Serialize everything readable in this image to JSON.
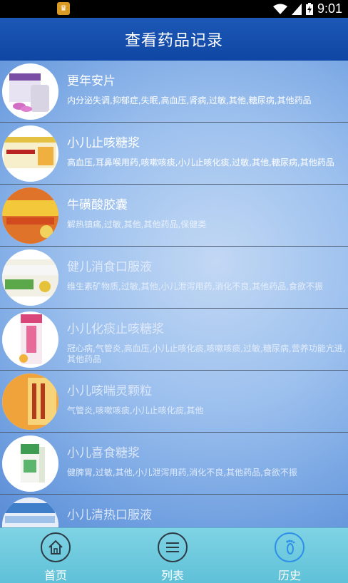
{
  "status_bar": {
    "time": "9:01",
    "app_icon": "launcher-app-icon"
  },
  "header": {
    "title": "查看药品记录"
  },
  "items": [
    {
      "name": "更年安片",
      "desc": "内分泌失调,抑郁症,失眠,高血压,肾病,过敏,其他,糖尿病,其他药品",
      "name_color": "#ffffff",
      "desc_color": "#ffffff",
      "thumb": "pill-box-purple"
    },
    {
      "name": "小儿止咳糖浆",
      "desc": "高血压,耳鼻喉用药,咳嗽咳痰,小儿止咳化痰,过敏,其他,糖尿病,其他药品",
      "name_color": "#ffffff",
      "desc_color": "#ffffff",
      "thumb": "syrup-box-yellow"
    },
    {
      "name": "牛磺酸胶囊",
      "desc": "解热镇痛,过敏,其他,其他药品,保健类",
      "name_color": "#ffffff",
      "desc_color": "#e8f1fb",
      "thumb": "capsule-box-orange"
    },
    {
      "name": "健儿消食口服液",
      "desc": "维生素矿物质,过敏,其他,小儿泄泻用药,消化不良,其他药品,食欲不振",
      "name_color": "#dfeafa",
      "desc_color": "#e4eefb",
      "thumb": "oral-liquid-box-green"
    },
    {
      "name": "小儿化痰止咳糖浆",
      "desc": "冠心病,气管炎,高血压,小儿止咳化痰,咳嗽咳痰,过敏,糖尿病,营养功能亢进,其他药品",
      "name_color": "#dde8f9",
      "desc_color": "#e2ecfa",
      "thumb": "syrup-bottle-pink"
    },
    {
      "name": "小儿咳喘灵颗粒",
      "desc": "气管炎,咳嗽咳痰,小儿止咳化痰,其他",
      "name_color": "#dbe7f8",
      "desc_color": "#e0ebfa",
      "thumb": "granule-box-orange"
    },
    {
      "name": "小儿喜食糖浆",
      "desc": "健脾胃,过敏,其他,小儿泄泻用药,消化不良,其他药品,食欲不振",
      "name_color": "#dae6f8",
      "desc_color": "#dfeafa",
      "thumb": "syrup-box-green"
    },
    {
      "name": "小儿清热口服液",
      "desc": "",
      "name_color": "#d8e5f7",
      "desc_color": "#dde9f9",
      "thumb": "oral-liquid-box-blue"
    }
  ],
  "tabbar": {
    "tabs": [
      {
        "label": "首页",
        "icon": "home-icon",
        "active": false
      },
      {
        "label": "列表",
        "icon": "list-icon",
        "active": false
      },
      {
        "label": "历史",
        "icon": "footprint-icon",
        "active": true
      }
    ]
  },
  "colors": {
    "header": "#1d58b7",
    "tabbar": "#7fd3e4",
    "tab_active": "#2e8ee8"
  }
}
